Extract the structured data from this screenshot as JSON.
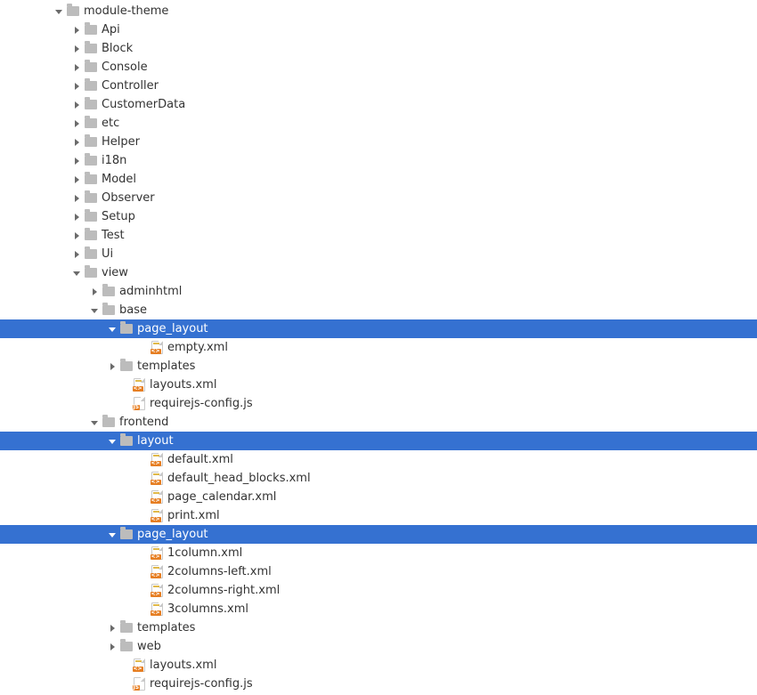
{
  "tree": [
    {
      "indent": 60,
      "arrow": "down",
      "icon": "folder",
      "label": "module-theme",
      "selected": false,
      "interact": true
    },
    {
      "indent": 80,
      "arrow": "right",
      "icon": "folder",
      "label": "Api",
      "selected": false,
      "interact": true
    },
    {
      "indent": 80,
      "arrow": "right",
      "icon": "folder",
      "label": "Block",
      "selected": false,
      "interact": true
    },
    {
      "indent": 80,
      "arrow": "right",
      "icon": "folder",
      "label": "Console",
      "selected": false,
      "interact": true
    },
    {
      "indent": 80,
      "arrow": "right",
      "icon": "folder",
      "label": "Controller",
      "selected": false,
      "interact": true
    },
    {
      "indent": 80,
      "arrow": "right",
      "icon": "folder",
      "label": "CustomerData",
      "selected": false,
      "interact": true
    },
    {
      "indent": 80,
      "arrow": "right",
      "icon": "folder",
      "label": "etc",
      "selected": false,
      "interact": true
    },
    {
      "indent": 80,
      "arrow": "right",
      "icon": "folder",
      "label": "Helper",
      "selected": false,
      "interact": true
    },
    {
      "indent": 80,
      "arrow": "right",
      "icon": "folder",
      "label": "i18n",
      "selected": false,
      "interact": true
    },
    {
      "indent": 80,
      "arrow": "right",
      "icon": "folder",
      "label": "Model",
      "selected": false,
      "interact": true
    },
    {
      "indent": 80,
      "arrow": "right",
      "icon": "folder",
      "label": "Observer",
      "selected": false,
      "interact": true
    },
    {
      "indent": 80,
      "arrow": "right",
      "icon": "folder",
      "label": "Setup",
      "selected": false,
      "interact": true
    },
    {
      "indent": 80,
      "arrow": "right",
      "icon": "folder",
      "label": "Test",
      "selected": false,
      "interact": true
    },
    {
      "indent": 80,
      "arrow": "right",
      "icon": "folder",
      "label": "Ui",
      "selected": false,
      "interact": true
    },
    {
      "indent": 80,
      "arrow": "down",
      "icon": "folder",
      "label": "view",
      "selected": false,
      "interact": true
    },
    {
      "indent": 100,
      "arrow": "right",
      "icon": "folder",
      "label": "adminhtml",
      "selected": false,
      "interact": true
    },
    {
      "indent": 100,
      "arrow": "down",
      "icon": "folder",
      "label": "base",
      "selected": false,
      "interact": true
    },
    {
      "indent": 120,
      "arrow": "down",
      "icon": "folder",
      "label": "page_layout",
      "selected": true,
      "interact": true
    },
    {
      "indent": 154,
      "arrow": "none",
      "icon": "xml",
      "label": "empty.xml",
      "selected": false,
      "interact": true
    },
    {
      "indent": 120,
      "arrow": "right",
      "icon": "folder",
      "label": "templates",
      "selected": false,
      "interact": true
    },
    {
      "indent": 134,
      "arrow": "none",
      "icon": "xml",
      "label": "layouts.xml",
      "selected": false,
      "interact": true
    },
    {
      "indent": 134,
      "arrow": "none",
      "icon": "js",
      "label": "requirejs-config.js",
      "selected": false,
      "interact": true
    },
    {
      "indent": 100,
      "arrow": "down",
      "icon": "folder",
      "label": "frontend",
      "selected": false,
      "interact": true
    },
    {
      "indent": 120,
      "arrow": "down",
      "icon": "folder",
      "label": "layout",
      "selected": true,
      "interact": true
    },
    {
      "indent": 154,
      "arrow": "none",
      "icon": "xml",
      "label": "default.xml",
      "selected": false,
      "interact": true
    },
    {
      "indent": 154,
      "arrow": "none",
      "icon": "xml",
      "label": "default_head_blocks.xml",
      "selected": false,
      "interact": true
    },
    {
      "indent": 154,
      "arrow": "none",
      "icon": "xml",
      "label": "page_calendar.xml",
      "selected": false,
      "interact": true
    },
    {
      "indent": 154,
      "arrow": "none",
      "icon": "xml",
      "label": "print.xml",
      "selected": false,
      "interact": true
    },
    {
      "indent": 120,
      "arrow": "down",
      "icon": "folder",
      "label": "page_layout",
      "selected": true,
      "interact": true
    },
    {
      "indent": 154,
      "arrow": "none",
      "icon": "xml",
      "label": "1column.xml",
      "selected": false,
      "interact": true
    },
    {
      "indent": 154,
      "arrow": "none",
      "icon": "xml",
      "label": "2columns-left.xml",
      "selected": false,
      "interact": true
    },
    {
      "indent": 154,
      "arrow": "none",
      "icon": "xml",
      "label": "2columns-right.xml",
      "selected": false,
      "interact": true
    },
    {
      "indent": 154,
      "arrow": "none",
      "icon": "xml",
      "label": "3columns.xml",
      "selected": false,
      "interact": true
    },
    {
      "indent": 120,
      "arrow": "right",
      "icon": "folder",
      "label": "templates",
      "selected": false,
      "interact": true
    },
    {
      "indent": 120,
      "arrow": "right",
      "icon": "folder",
      "label": "web",
      "selected": false,
      "interact": true
    },
    {
      "indent": 134,
      "arrow": "none",
      "icon": "xml",
      "label": "layouts.xml",
      "selected": false,
      "interact": true
    },
    {
      "indent": 134,
      "arrow": "none",
      "icon": "js",
      "label": "requirejs-config.js",
      "selected": false,
      "interact": true
    }
  ]
}
